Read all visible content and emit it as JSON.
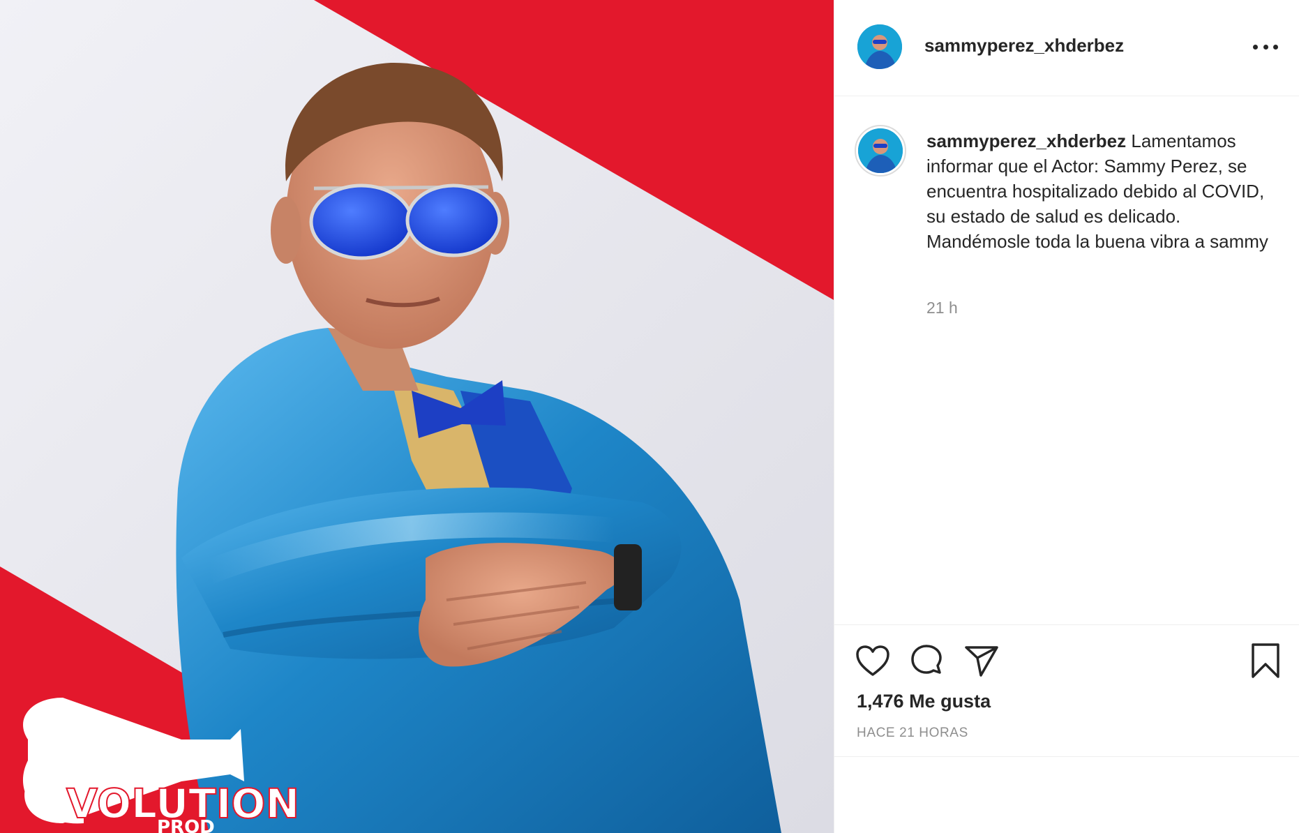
{
  "post": {
    "username": "sammyperez_xhderbez",
    "caption_username": "sammyperez_xhderbez",
    "caption_text": "Lamentamos informar que el Actor: Sammy Perez, se encuentra hospitalizado debido al COVID, su estado de salud es delicado. Mandémosle toda la buena vibra a sammy",
    "caption_time": "21 h",
    "likes": "1,476 Me gusta",
    "posted_ago": "HACE 21 HORAS"
  },
  "image": {
    "logo_main": "VOLUTION",
    "logo_sub": "PROD"
  },
  "colors": {
    "accent_red": "#e3182c",
    "suit_blue": "#1f8fd0",
    "text_primary": "#262626",
    "text_secondary": "#8e8e8e",
    "divider": "#efefef"
  },
  "icons": {
    "more": "more-dots-icon",
    "like": "heart-icon",
    "comment": "comment-icon",
    "share": "paper-plane-icon",
    "save": "bookmark-icon"
  }
}
